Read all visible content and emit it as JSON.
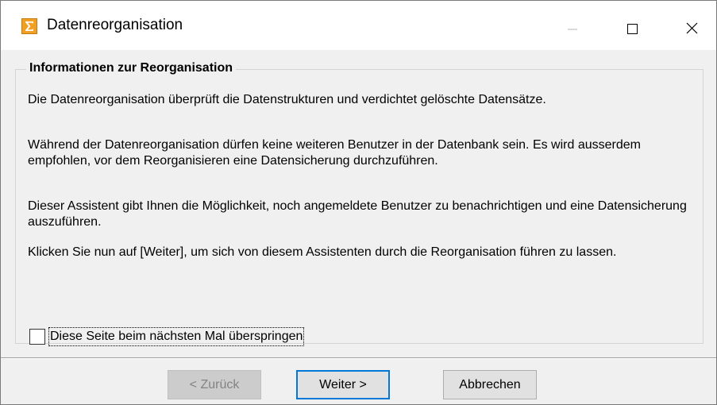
{
  "window": {
    "title": "Datenreorganisation",
    "icon": "sigma-icon",
    "controls": {
      "minimize": "minimize-icon",
      "maximize": "maximize-icon",
      "close": "close-icon"
    }
  },
  "info": {
    "heading": "Informationen zur Reorganisation",
    "paragraphs": [
      "Die Datenreorganisation überprüft die Datenstrukturen und verdichtet gelöschte Datensätze.",
      "Während der Datenreorganisation dürfen keine weiteren Benutzer in der Datenbank sein. Es wird ausserdem empfohlen, vor dem Reorganisieren eine Datensicherung durchzuführen.",
      "Dieser Assistent gibt Ihnen die Möglichkeit, noch angemeldete Benutzer zu benachrichtigen und eine Datensicherung auszuführen.",
      "Klicken Sie nun auf [Weiter], um sich von diesem Assistenten durch die Reorganisation führen zu lassen."
    ]
  },
  "skip_option": {
    "label": "Diese Seite beim nächsten Mal überspringen",
    "checked": false
  },
  "buttons": {
    "back": "< Zurück",
    "next": "Weiter >",
    "cancel": "Abbrechen"
  },
  "colors": {
    "accent": "#0078d7",
    "icon": "#f2a024",
    "background": "#f0f0f0"
  }
}
